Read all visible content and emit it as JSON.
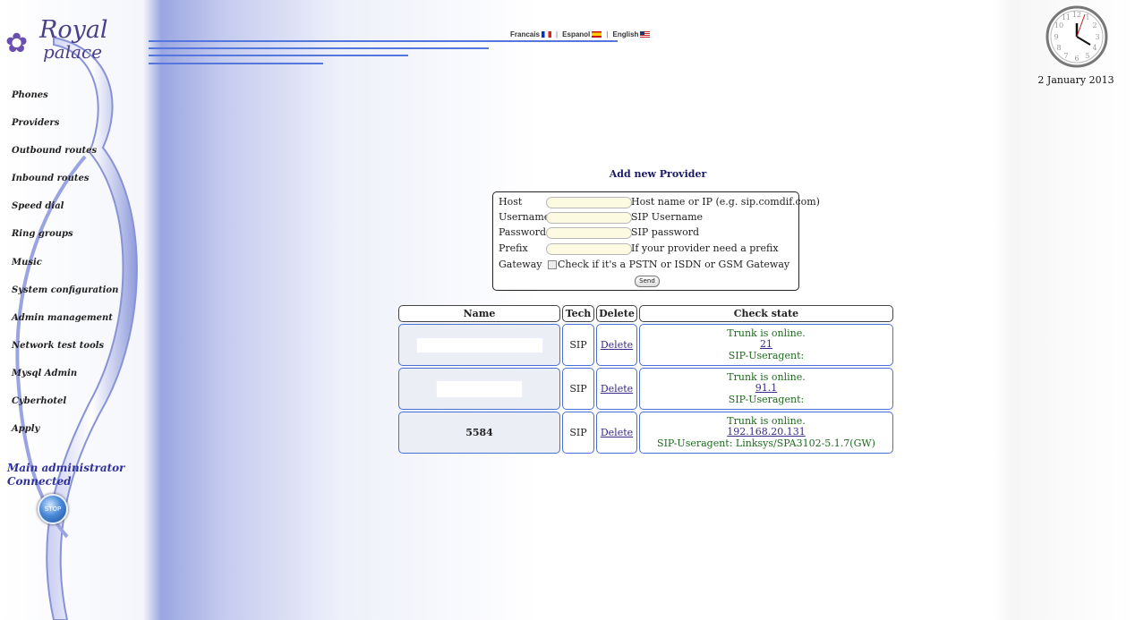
{
  "logo": {
    "top": "Royal",
    "bottom": "palace"
  },
  "lang": {
    "items": [
      {
        "label": "Francais",
        "flag": "fr-flag-icon"
      },
      {
        "label": "Espanol",
        "flag": "es-flag-icon"
      },
      {
        "label": "English",
        "flag": "us-flag-icon"
      }
    ]
  },
  "clock": {
    "date": "2 January 2013",
    "hour_angle_hint": "12:35"
  },
  "sidebar": {
    "items": [
      {
        "label": "Phones"
      },
      {
        "label": "Providers"
      },
      {
        "label": "Outbound routes"
      },
      {
        "label": "Inbound routes"
      },
      {
        "label": "Speed dial"
      },
      {
        "label": "Ring groups"
      },
      {
        "label": "Music"
      },
      {
        "label": "System configuration"
      },
      {
        "label": "Admin management"
      },
      {
        "label": "Network test tools"
      },
      {
        "label": "Mysql Admin"
      },
      {
        "label": "Cyberhotel"
      },
      {
        "label": "Apply"
      }
    ],
    "status_line1": "Main administrator",
    "status_line2": "Connected",
    "stop_label": "STOP"
  },
  "form": {
    "title": "Add new Provider",
    "rows": [
      {
        "label": "Host",
        "value": "",
        "hint": "Host name or IP (e.g. sip.comdif.com)"
      },
      {
        "label": "Username",
        "value": "",
        "hint": "SIP Username"
      },
      {
        "label": "Password",
        "value": "",
        "hint": "SIP password"
      },
      {
        "label": "Prefix",
        "value": "",
        "hint": "If your provider need a prefix"
      }
    ],
    "gateway_label": "Gateway",
    "gateway_check_label": "Check if it's a PSTN or ISDN or GSM Gateway",
    "gateway_checked": false,
    "send_label": "Send"
  },
  "table": {
    "headers": {
      "name": "Name",
      "tech": "Tech",
      "delete": "Delete",
      "state": "Check state"
    },
    "rows": [
      {
        "name": "",
        "tech": "SIP",
        "delete": "Delete",
        "status": "Trunk is online.",
        "address": "21",
        "useragent": "SIP-Useragent:"
      },
      {
        "name": "",
        "tech": "SIP",
        "delete": "Delete",
        "status": "Trunk is online.",
        "address": "91.1",
        "useragent": "SIP-Useragent:"
      },
      {
        "name": "5584",
        "tech": "SIP",
        "delete": "Delete",
        "status": "Trunk is online.",
        "address": "192.168.20.131",
        "useragent": "SIP-Useragent: Linksys/SPA3102-5.1.7(GW)"
      }
    ]
  },
  "colors": {
    "accent": "#5577dd",
    "status_green": "#1d6b1d",
    "link": "#3a2a8a",
    "title": "#1a1a66"
  }
}
